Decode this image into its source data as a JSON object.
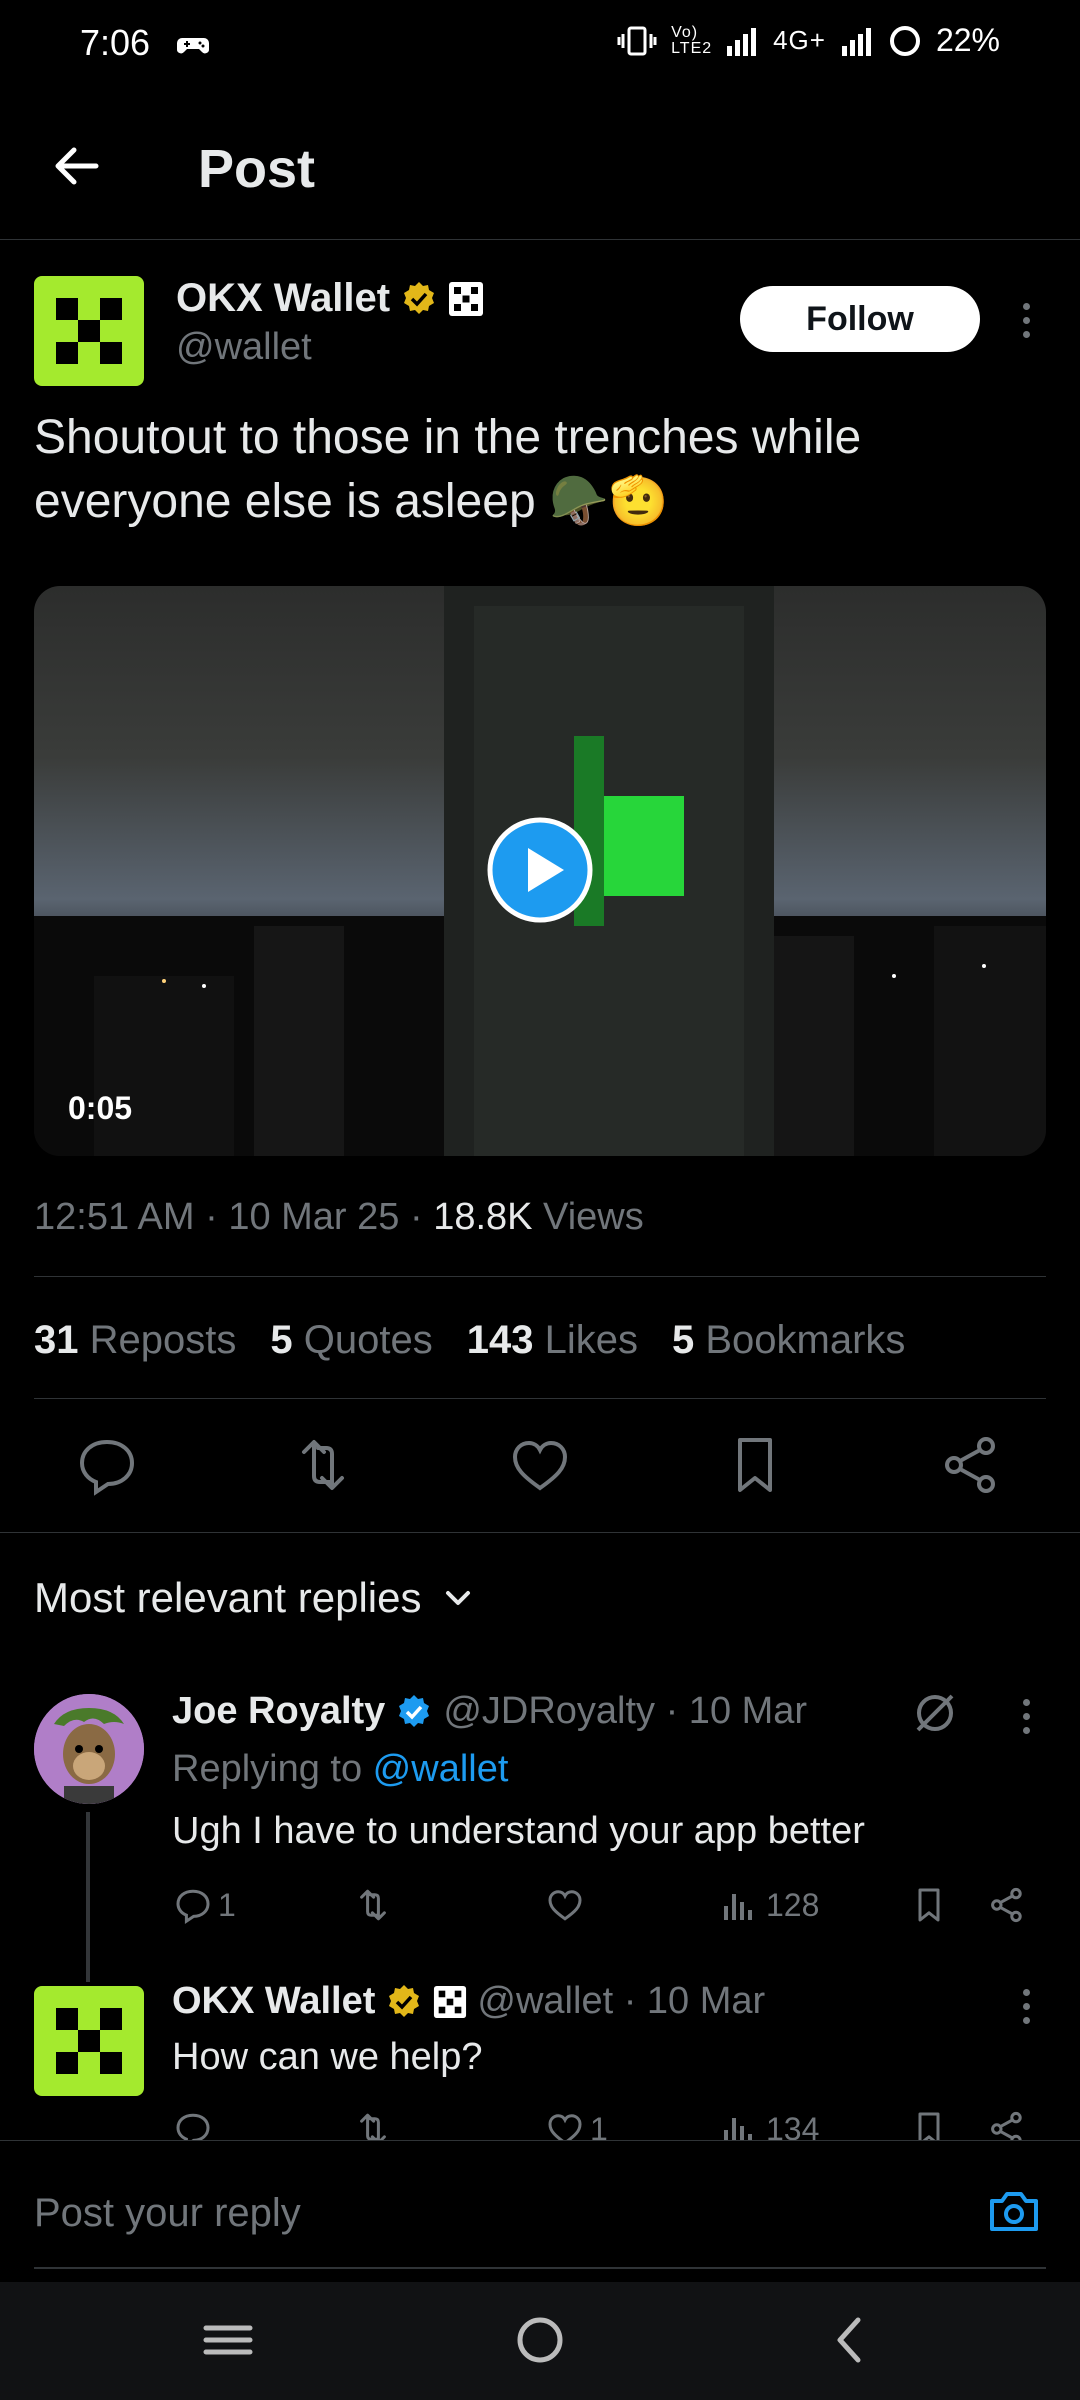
{
  "status_bar": {
    "time": "7:06",
    "network": "4G+",
    "volte": "Vo) LTE2",
    "battery": "22%"
  },
  "header": {
    "title": "Post"
  },
  "post": {
    "author_name": "OKX Wallet",
    "author_handle": "@wallet",
    "follow_label": "Follow",
    "text": "Shoutout to those in the trenches while everyone else is asleep 🪖🫡",
    "video_duration": "0:05",
    "timestamp": "12:51 AM · 10 Mar 25 · ",
    "views_count": "18.8K",
    "views_label": " Views",
    "stats": [
      {
        "count": "31",
        "label": "Reposts"
      },
      {
        "count": "5",
        "label": "Quotes"
      },
      {
        "count": "143",
        "label": "Likes"
      },
      {
        "count": "5",
        "label": "Bookmarks"
      }
    ]
  },
  "replies_sort": {
    "label": "Most relevant replies"
  },
  "replies": [
    {
      "name": "Joe Royalty",
      "handle": "@JDRoyalty · 10 Mar",
      "replying_prefix": "Replying to ",
      "replying_to": "@wallet",
      "body": "Ugh I have to understand your app better",
      "reply_count": "1",
      "repost_count": "",
      "like_count": "",
      "views": "128"
    },
    {
      "name": "OKX Wallet",
      "handle": "@wallet · 10 Mar",
      "body": "How can we help?",
      "reply_count": "",
      "repost_count": "",
      "like_count": "1",
      "views": "134"
    }
  ],
  "composer": {
    "placeholder": "Post your reply"
  },
  "colors": {
    "background": "#000000",
    "text": "#e7e9ea",
    "muted": "#71767b",
    "accent": "#1d9bf0",
    "okx_green": "#a4ea2e",
    "verified_gold": "#e2b719"
  }
}
